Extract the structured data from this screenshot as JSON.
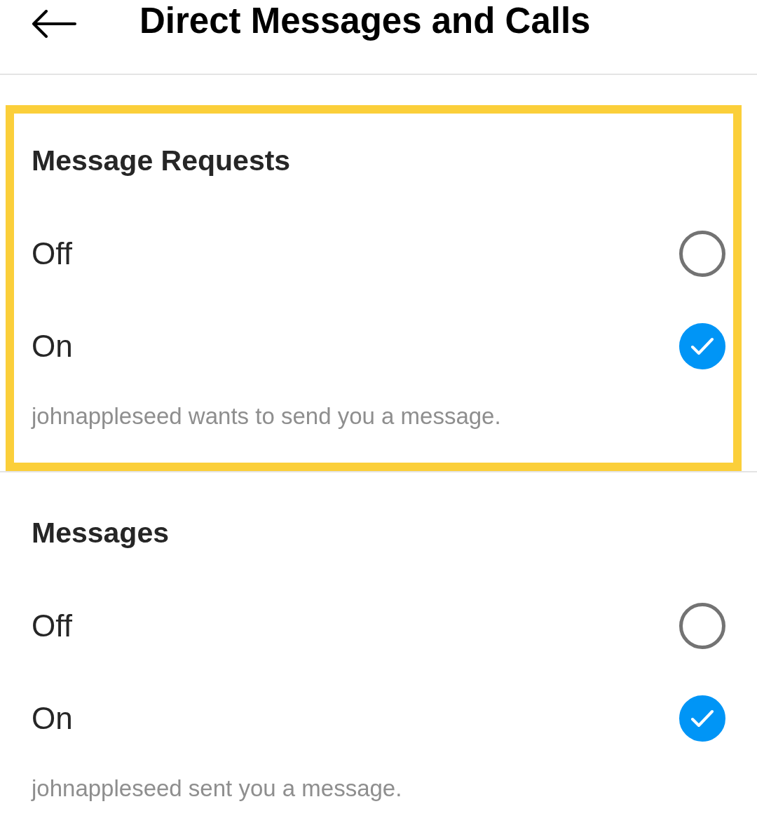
{
  "header": {
    "title": "Direct Messages and Calls"
  },
  "sections": [
    {
      "heading": "Message Requests",
      "highlighted": true,
      "options": [
        {
          "label": "Off",
          "selected": false
        },
        {
          "label": "On",
          "selected": true
        }
      ],
      "preview": "johnappleseed wants to send you a message."
    },
    {
      "heading": "Messages",
      "highlighted": false,
      "options": [
        {
          "label": "Off",
          "selected": false
        },
        {
          "label": "On",
          "selected": true
        }
      ],
      "preview": "johnappleseed sent you a message."
    }
  ]
}
